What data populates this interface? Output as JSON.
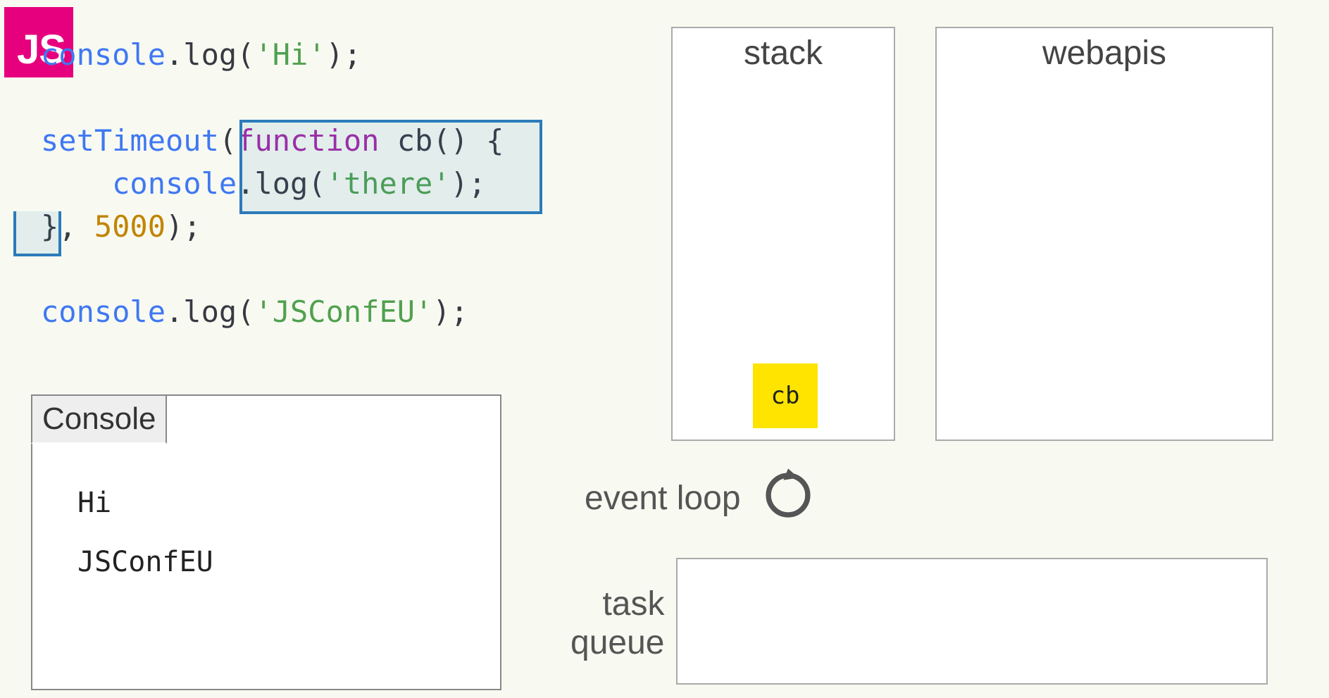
{
  "badge": {
    "text": "JS"
  },
  "code": {
    "line1_a": "console",
    "line1_b": ".log(",
    "line1_c": "'Hi'",
    "line1_d": ");",
    "line2_a": "setTimeout",
    "line2_b": "(",
    "line2_c": "function",
    "line2_d": " cb() {",
    "line3_a": "    console",
    "line3_b": ".log(",
    "line3_c": "'there'",
    "line3_d": ");",
    "line4_a": "}, ",
    "line4_b": "5000",
    "line4_c": ");",
    "line5_a": "console",
    "line5_b": ".log(",
    "line5_c": "'JSConfEU'",
    "line5_d": ");"
  },
  "console": {
    "title": "Console",
    "output": [
      "Hi",
      "JSConfEU"
    ]
  },
  "panels": {
    "stack": "stack",
    "webapis": "webapis",
    "event_loop": "event loop",
    "task_queue": "task\nqueue"
  },
  "stack_items": [
    "cb"
  ]
}
